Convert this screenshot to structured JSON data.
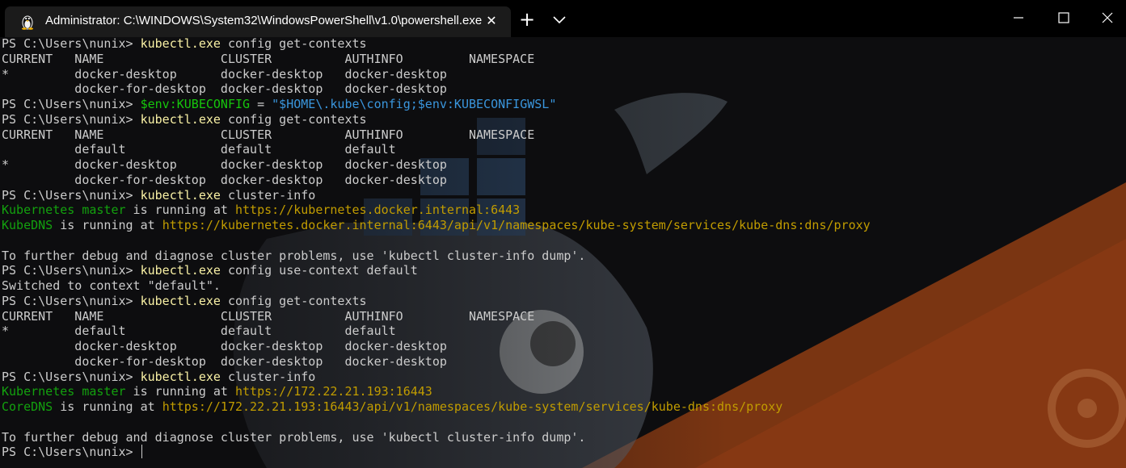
{
  "window": {
    "tab_title": "Administrator: C:\\WINDOWS\\System32\\WindowsPowerShell\\v1.0\\powershell.exe",
    "tab_icon": "linux-tux-icon",
    "new_tab_label": "+",
    "close_tab_label": "✕"
  },
  "terminal": {
    "lines": [
      [
        {
          "t": "PS C:\\Users\\nunix> ",
          "c": "default"
        },
        {
          "t": "kubectl.exe",
          "c": "cmd"
        },
        {
          "t": " config get-contexts",
          "c": "default"
        }
      ],
      [
        {
          "t": "CURRENT   NAME                CLUSTER          AUTHINFO         NAMESPACE",
          "c": "default"
        }
      ],
      [
        {
          "t": "*         docker-desktop      docker-desktop   docker-desktop",
          "c": "default"
        }
      ],
      [
        {
          "t": "          docker-for-desktop  docker-desktop   docker-desktop",
          "c": "default"
        }
      ],
      [
        {
          "t": "PS C:\\Users\\nunix> ",
          "c": "default"
        },
        {
          "t": "$env:KUBECONFIG",
          "c": "var"
        },
        {
          "t": " = ",
          "c": "default"
        },
        {
          "t": "\"$HOME\\.kube\\config;$env:KUBECONFIGWSL\"",
          "c": "str"
        }
      ],
      [
        {
          "t": "PS C:\\Users\\nunix> ",
          "c": "default"
        },
        {
          "t": "kubectl.exe",
          "c": "cmd"
        },
        {
          "t": " config get-contexts",
          "c": "default"
        }
      ],
      [
        {
          "t": "CURRENT   NAME                CLUSTER          AUTHINFO         NAMESPACE",
          "c": "default"
        }
      ],
      [
        {
          "t": "          default             default          default",
          "c": "default"
        }
      ],
      [
        {
          "t": "*         docker-desktop      docker-desktop   docker-desktop",
          "c": "default"
        }
      ],
      [
        {
          "t": "          docker-for-desktop  docker-desktop   docker-desktop",
          "c": "default"
        }
      ],
      [
        {
          "t": "PS C:\\Users\\nunix> ",
          "c": "default"
        },
        {
          "t": "kubectl.exe",
          "c": "cmd"
        },
        {
          "t": " cluster-info",
          "c": "default"
        }
      ],
      [
        {
          "t": "Kubernetes master",
          "c": "green"
        },
        {
          "t": " is running at ",
          "c": "default"
        },
        {
          "t": "https://kubernetes.docker.internal:6443",
          "c": "url"
        }
      ],
      [
        {
          "t": "KubeDNS",
          "c": "green"
        },
        {
          "t": " is running at ",
          "c": "default"
        },
        {
          "t": "https://kubernetes.docker.internal:6443/api/v1/namespaces/kube-system/services/kube-dns:dns/proxy",
          "c": "url"
        }
      ],
      [
        {
          "t": "",
          "c": "default"
        }
      ],
      [
        {
          "t": "To further debug and diagnose cluster problems, use 'kubectl cluster-info dump'.",
          "c": "default"
        }
      ],
      [
        {
          "t": "PS C:\\Users\\nunix> ",
          "c": "default"
        },
        {
          "t": "kubectl.exe",
          "c": "cmd"
        },
        {
          "t": " config use-context default",
          "c": "default"
        }
      ],
      [
        {
          "t": "Switched to context \"default\".",
          "c": "default"
        }
      ],
      [
        {
          "t": "PS C:\\Users\\nunix> ",
          "c": "default"
        },
        {
          "t": "kubectl.exe",
          "c": "cmd"
        },
        {
          "t": " config get-contexts",
          "c": "default"
        }
      ],
      [
        {
          "t": "CURRENT   NAME                CLUSTER          AUTHINFO         NAMESPACE",
          "c": "default"
        }
      ],
      [
        {
          "t": "*         default             default          default",
          "c": "default"
        }
      ],
      [
        {
          "t": "          docker-desktop      docker-desktop   docker-desktop",
          "c": "default"
        }
      ],
      [
        {
          "t": "          docker-for-desktop  docker-desktop   docker-desktop",
          "c": "default"
        }
      ],
      [
        {
          "t": "PS C:\\Users\\nunix> ",
          "c": "default"
        },
        {
          "t": "kubectl.exe",
          "c": "cmd"
        },
        {
          "t": " cluster-info",
          "c": "default"
        }
      ],
      [
        {
          "t": "Kubernetes master",
          "c": "green"
        },
        {
          "t": " is running at ",
          "c": "default"
        },
        {
          "t": "https://172.22.21.193:16443",
          "c": "url"
        }
      ],
      [
        {
          "t": "CoreDNS",
          "c": "green"
        },
        {
          "t": " is running at ",
          "c": "default"
        },
        {
          "t": "https://172.22.21.193:16443/api/v1/namespaces/kube-system/services/kube-dns:dns/proxy",
          "c": "url"
        }
      ],
      [
        {
          "t": "",
          "c": "default"
        }
      ],
      [
        {
          "t": "To further debug and diagnose cluster problems, use 'kubectl cluster-info dump'.",
          "c": "default"
        }
      ],
      [
        {
          "t": "PS C:\\Users\\nunix> ",
          "c": "default"
        }
      ]
    ]
  },
  "colors": {
    "background": "#0c0c0c",
    "foreground": "#cccccc",
    "command": "#f9f1a5",
    "variable": "#16c60c",
    "string": "#3a96dd",
    "green": "#13a10e",
    "url": "#c19c00",
    "bg_orange": "#8a3a14"
  }
}
